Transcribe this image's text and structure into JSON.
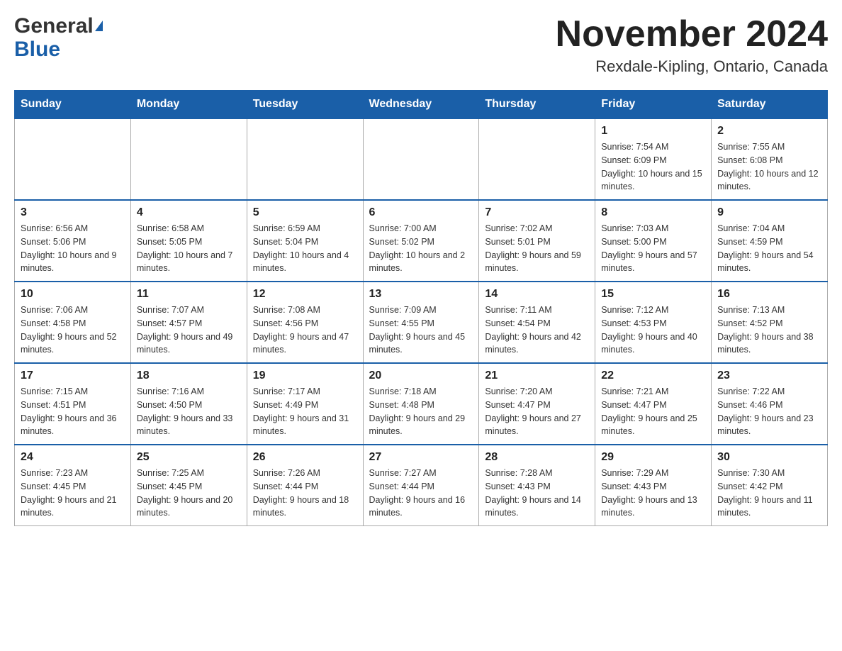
{
  "header": {
    "logo_general": "General",
    "logo_blue": "Blue",
    "month_title": "November 2024",
    "location": "Rexdale-Kipling, Ontario, Canada"
  },
  "days_of_week": [
    "Sunday",
    "Monday",
    "Tuesday",
    "Wednesday",
    "Thursday",
    "Friday",
    "Saturday"
  ],
  "weeks": [
    {
      "days": [
        {
          "num": "",
          "sunrise": "",
          "sunset": "",
          "daylight": "",
          "empty": true
        },
        {
          "num": "",
          "sunrise": "",
          "sunset": "",
          "daylight": "",
          "empty": true
        },
        {
          "num": "",
          "sunrise": "",
          "sunset": "",
          "daylight": "",
          "empty": true
        },
        {
          "num": "",
          "sunrise": "",
          "sunset": "",
          "daylight": "",
          "empty": true
        },
        {
          "num": "",
          "sunrise": "",
          "sunset": "",
          "daylight": "",
          "empty": true
        },
        {
          "num": "1",
          "sunrise": "Sunrise: 7:54 AM",
          "sunset": "Sunset: 6:09 PM",
          "daylight": "Daylight: 10 hours and 15 minutes.",
          "empty": false
        },
        {
          "num": "2",
          "sunrise": "Sunrise: 7:55 AM",
          "sunset": "Sunset: 6:08 PM",
          "daylight": "Daylight: 10 hours and 12 minutes.",
          "empty": false
        }
      ]
    },
    {
      "days": [
        {
          "num": "3",
          "sunrise": "Sunrise: 6:56 AM",
          "sunset": "Sunset: 5:06 PM",
          "daylight": "Daylight: 10 hours and 9 minutes.",
          "empty": false
        },
        {
          "num": "4",
          "sunrise": "Sunrise: 6:58 AM",
          "sunset": "Sunset: 5:05 PM",
          "daylight": "Daylight: 10 hours and 7 minutes.",
          "empty": false
        },
        {
          "num": "5",
          "sunrise": "Sunrise: 6:59 AM",
          "sunset": "Sunset: 5:04 PM",
          "daylight": "Daylight: 10 hours and 4 minutes.",
          "empty": false
        },
        {
          "num": "6",
          "sunrise": "Sunrise: 7:00 AM",
          "sunset": "Sunset: 5:02 PM",
          "daylight": "Daylight: 10 hours and 2 minutes.",
          "empty": false
        },
        {
          "num": "7",
          "sunrise": "Sunrise: 7:02 AM",
          "sunset": "Sunset: 5:01 PM",
          "daylight": "Daylight: 9 hours and 59 minutes.",
          "empty": false
        },
        {
          "num": "8",
          "sunrise": "Sunrise: 7:03 AM",
          "sunset": "Sunset: 5:00 PM",
          "daylight": "Daylight: 9 hours and 57 minutes.",
          "empty": false
        },
        {
          "num": "9",
          "sunrise": "Sunrise: 7:04 AM",
          "sunset": "Sunset: 4:59 PM",
          "daylight": "Daylight: 9 hours and 54 minutes.",
          "empty": false
        }
      ]
    },
    {
      "days": [
        {
          "num": "10",
          "sunrise": "Sunrise: 7:06 AM",
          "sunset": "Sunset: 4:58 PM",
          "daylight": "Daylight: 9 hours and 52 minutes.",
          "empty": false
        },
        {
          "num": "11",
          "sunrise": "Sunrise: 7:07 AM",
          "sunset": "Sunset: 4:57 PM",
          "daylight": "Daylight: 9 hours and 49 minutes.",
          "empty": false
        },
        {
          "num": "12",
          "sunrise": "Sunrise: 7:08 AM",
          "sunset": "Sunset: 4:56 PM",
          "daylight": "Daylight: 9 hours and 47 minutes.",
          "empty": false
        },
        {
          "num": "13",
          "sunrise": "Sunrise: 7:09 AM",
          "sunset": "Sunset: 4:55 PM",
          "daylight": "Daylight: 9 hours and 45 minutes.",
          "empty": false
        },
        {
          "num": "14",
          "sunrise": "Sunrise: 7:11 AM",
          "sunset": "Sunset: 4:54 PM",
          "daylight": "Daylight: 9 hours and 42 minutes.",
          "empty": false
        },
        {
          "num": "15",
          "sunrise": "Sunrise: 7:12 AM",
          "sunset": "Sunset: 4:53 PM",
          "daylight": "Daylight: 9 hours and 40 minutes.",
          "empty": false
        },
        {
          "num": "16",
          "sunrise": "Sunrise: 7:13 AM",
          "sunset": "Sunset: 4:52 PM",
          "daylight": "Daylight: 9 hours and 38 minutes.",
          "empty": false
        }
      ]
    },
    {
      "days": [
        {
          "num": "17",
          "sunrise": "Sunrise: 7:15 AM",
          "sunset": "Sunset: 4:51 PM",
          "daylight": "Daylight: 9 hours and 36 minutes.",
          "empty": false
        },
        {
          "num": "18",
          "sunrise": "Sunrise: 7:16 AM",
          "sunset": "Sunset: 4:50 PM",
          "daylight": "Daylight: 9 hours and 33 minutes.",
          "empty": false
        },
        {
          "num": "19",
          "sunrise": "Sunrise: 7:17 AM",
          "sunset": "Sunset: 4:49 PM",
          "daylight": "Daylight: 9 hours and 31 minutes.",
          "empty": false
        },
        {
          "num": "20",
          "sunrise": "Sunrise: 7:18 AM",
          "sunset": "Sunset: 4:48 PM",
          "daylight": "Daylight: 9 hours and 29 minutes.",
          "empty": false
        },
        {
          "num": "21",
          "sunrise": "Sunrise: 7:20 AM",
          "sunset": "Sunset: 4:47 PM",
          "daylight": "Daylight: 9 hours and 27 minutes.",
          "empty": false
        },
        {
          "num": "22",
          "sunrise": "Sunrise: 7:21 AM",
          "sunset": "Sunset: 4:47 PM",
          "daylight": "Daylight: 9 hours and 25 minutes.",
          "empty": false
        },
        {
          "num": "23",
          "sunrise": "Sunrise: 7:22 AM",
          "sunset": "Sunset: 4:46 PM",
          "daylight": "Daylight: 9 hours and 23 minutes.",
          "empty": false
        }
      ]
    },
    {
      "days": [
        {
          "num": "24",
          "sunrise": "Sunrise: 7:23 AM",
          "sunset": "Sunset: 4:45 PM",
          "daylight": "Daylight: 9 hours and 21 minutes.",
          "empty": false
        },
        {
          "num": "25",
          "sunrise": "Sunrise: 7:25 AM",
          "sunset": "Sunset: 4:45 PM",
          "daylight": "Daylight: 9 hours and 20 minutes.",
          "empty": false
        },
        {
          "num": "26",
          "sunrise": "Sunrise: 7:26 AM",
          "sunset": "Sunset: 4:44 PM",
          "daylight": "Daylight: 9 hours and 18 minutes.",
          "empty": false
        },
        {
          "num": "27",
          "sunrise": "Sunrise: 7:27 AM",
          "sunset": "Sunset: 4:44 PM",
          "daylight": "Daylight: 9 hours and 16 minutes.",
          "empty": false
        },
        {
          "num": "28",
          "sunrise": "Sunrise: 7:28 AM",
          "sunset": "Sunset: 4:43 PM",
          "daylight": "Daylight: 9 hours and 14 minutes.",
          "empty": false
        },
        {
          "num": "29",
          "sunrise": "Sunrise: 7:29 AM",
          "sunset": "Sunset: 4:43 PM",
          "daylight": "Daylight: 9 hours and 13 minutes.",
          "empty": false
        },
        {
          "num": "30",
          "sunrise": "Sunrise: 7:30 AM",
          "sunset": "Sunset: 4:42 PM",
          "daylight": "Daylight: 9 hours and 11 minutes.",
          "empty": false
        }
      ]
    }
  ]
}
